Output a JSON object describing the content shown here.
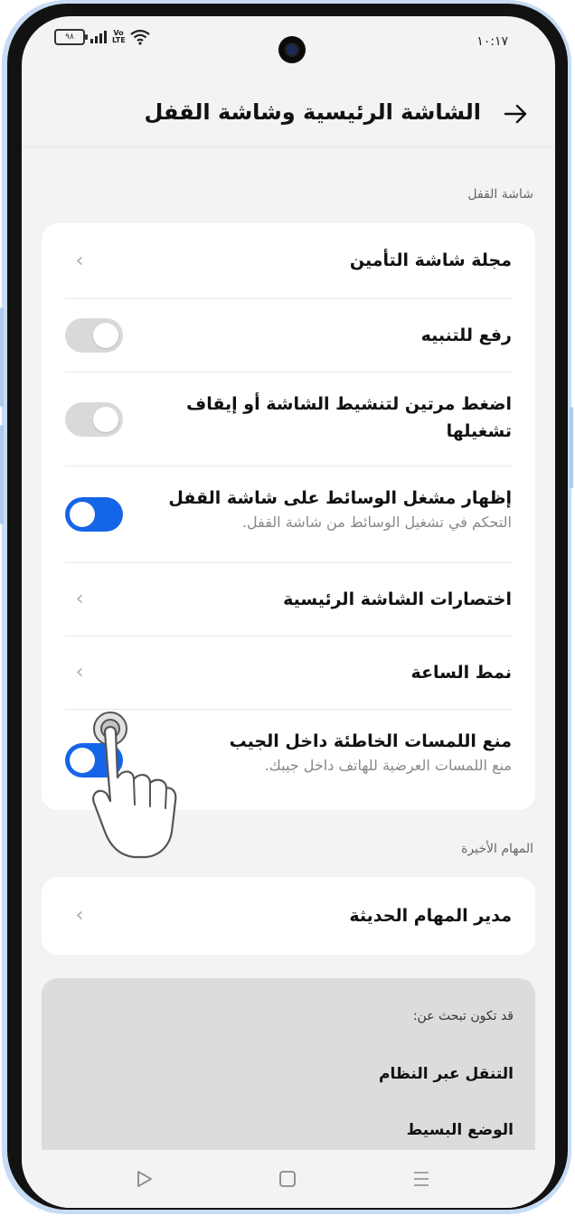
{
  "status": {
    "time": "١٠:١٧",
    "battery": "٩٨",
    "network": "Vo LTE"
  },
  "header": {
    "title": "الشاشة الرئيسية وشاشة القفل"
  },
  "lock_section": {
    "label": "شاشة القفل",
    "rows": [
      {
        "title": "مجلة شاشة التأمين",
        "control": "chevron"
      },
      {
        "title": "رفع للتنبيه",
        "control": "toggle",
        "on": false
      },
      {
        "title": "اضغط مرتين لتنشيط الشاشة أو إيقاف تشغيلها",
        "control": "toggle",
        "on": false
      },
      {
        "title": "إظهار مشغل الوسائط على شاشة القفل",
        "subtitle": "التحكم في تشغيل الوسائط من شاشة القفل.",
        "control": "toggle",
        "on": true
      },
      {
        "title": "اختصارات الشاشة الرئيسية",
        "control": "chevron"
      },
      {
        "title": "نمط الساعة",
        "control": "chevron"
      },
      {
        "title": "منع اللمسات الخاطئة داخل الجيب",
        "subtitle": "منع اللمسات العرضية للهاتف داخل جيبك.",
        "control": "toggle",
        "on": true
      }
    ]
  },
  "recent_section": {
    "label": "المهام الأخيرة",
    "rows": [
      {
        "title": "مدير المهام الحديثة",
        "control": "chevron"
      }
    ]
  },
  "suggestions": {
    "title": "قد تكون تبحث عن:",
    "items": [
      "التنقل عبر النظام",
      "الوضع البسيط"
    ]
  },
  "icons": {
    "back": "arrow-right-icon",
    "chevron": "chevron-left-icon",
    "nav_back": "triangle-back-icon",
    "nav_home": "square-home-icon",
    "nav_menu": "menu-lines-icon"
  },
  "colors": {
    "accent": "#1565e8",
    "background": "#f3f3f3",
    "card": "#ffffff",
    "frame": "#c7dcf4"
  }
}
